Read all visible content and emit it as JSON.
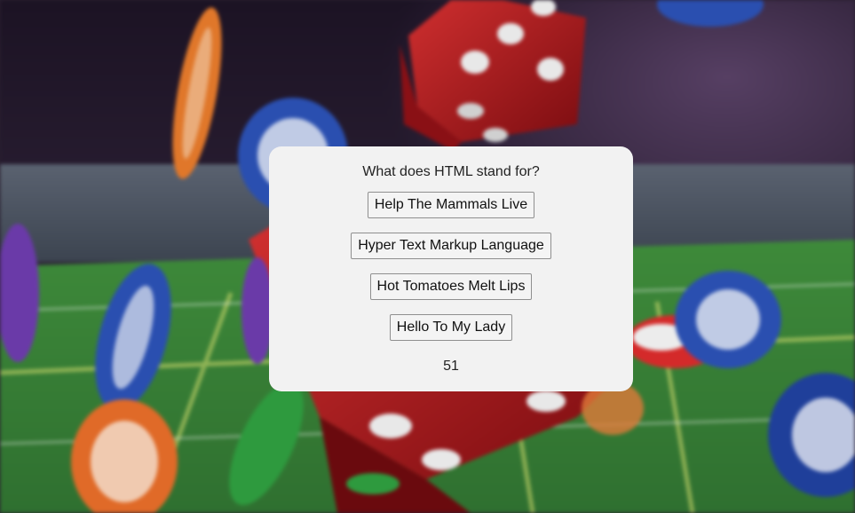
{
  "quiz": {
    "question": "What does HTML stand for?",
    "answers": [
      "Help The Mammals Live",
      "Hyper Text Markup Language",
      "Hot Tomatoes Melt Lips",
      "Hello To My Lady"
    ],
    "score": "51"
  },
  "background": {
    "image": "casino-dice-and-chips"
  }
}
